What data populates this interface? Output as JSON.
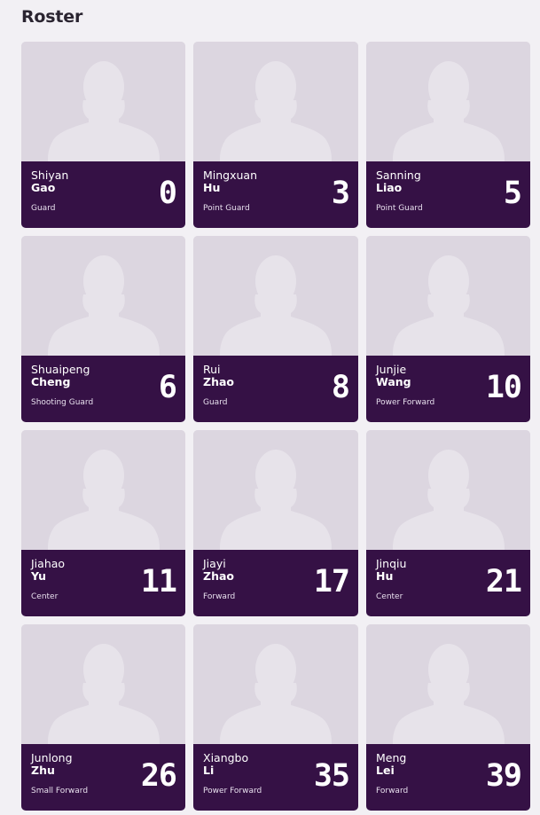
{
  "header": {
    "title": "Roster"
  },
  "colors": {
    "background": "#f2f0f4",
    "card_photo_bg": "#dcd6e0",
    "card_info_bg": "#351145",
    "silhouette": "#e9e5ec"
  },
  "players": [
    {
      "first": "Shiyan",
      "last": "Gao",
      "position": "Guard",
      "number": "0"
    },
    {
      "first": "Mingxuan",
      "last": "Hu",
      "position": "Point Guard",
      "number": "3"
    },
    {
      "first": "Sanning",
      "last": "Liao",
      "position": "Point Guard",
      "number": "5"
    },
    {
      "first": "Shuaipeng",
      "last": "Cheng",
      "position": "Shooting Guard",
      "number": "6"
    },
    {
      "first": "Rui",
      "last": "Zhao",
      "position": "Guard",
      "number": "8"
    },
    {
      "first": "Junjie",
      "last": "Wang",
      "position": "Power Forward",
      "number": "10"
    },
    {
      "first": "Jiahao",
      "last": "Yu",
      "position": "Center",
      "number": "11"
    },
    {
      "first": "Jiayi",
      "last": "Zhao",
      "position": "Forward",
      "number": "17"
    },
    {
      "first": "Jinqiu",
      "last": "Hu",
      "position": "Center",
      "number": "21"
    },
    {
      "first": "Junlong",
      "last": "Zhu",
      "position": "Small Forward",
      "number": "26"
    },
    {
      "first": "Xiangbo",
      "last": "Li",
      "position": "Power Forward",
      "number": "35"
    },
    {
      "first": "Meng",
      "last": "Lei",
      "position": "Forward",
      "number": "39"
    }
  ]
}
